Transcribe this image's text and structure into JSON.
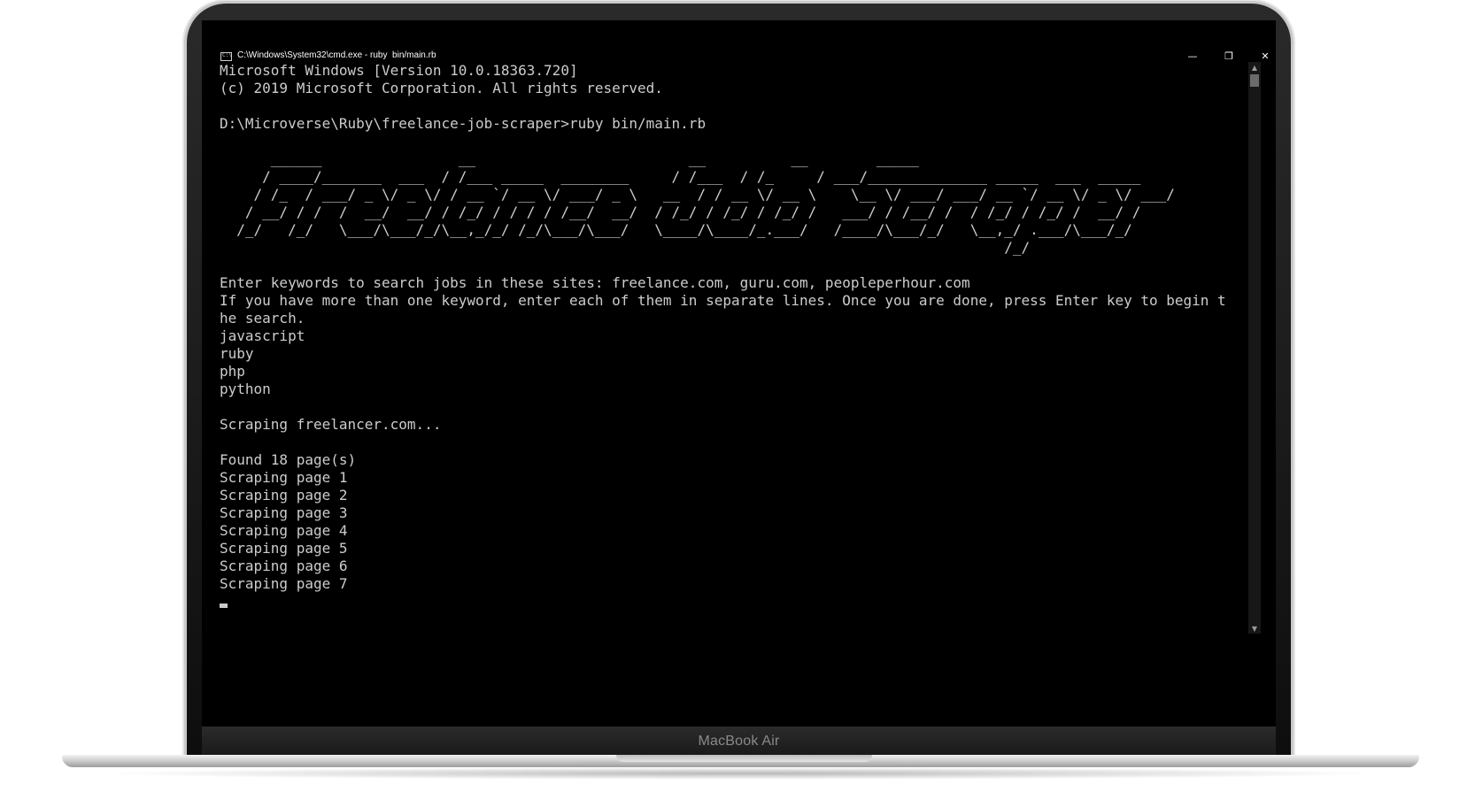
{
  "device": {
    "label": "MacBook Air"
  },
  "window": {
    "title": "C:\\Windows\\System32\\cmd.exe - ruby  bin/main.rb",
    "minimize_glyph": "—",
    "maximize_glyph": "❐",
    "close_glyph": "✕"
  },
  "terminal": {
    "lines": [
      "Microsoft Windows [Version 10.0.18363.720]",
      "(c) 2019 Microsoft Corporation. All rights reserved.",
      "",
      "D:\\Microverse\\Ruby\\freelance-job-scraper>ruby bin/main.rb",
      "",
      "      ______                __                         __          __        _____",
      "     / ____/_______  ___  / /___ _____  ________     / /___  / /_     / ___/______________ _____  ___  _____",
      "    / /_  / ___/ _ \\/ _ \\/ / __ `/ __ \\/ ___/ _ \\   __  / / __ \\/ __ \\    \\__ \\/ ___/ ___/ __ `/ __ \\/ _ \\/ ___/",
      "   / __/ / /  /  __/  __/ / /_/ / / / / /__/  __/  / /_/ / /_/ / /_/ /   ___/ / /__/ /  / /_/ / /_/ /  __/ /",
      "  /_/   /_/   \\___/\\___/_/\\__,_/_/ /_/\\___/\\___/   \\____/\\____/_.___/   /____/\\___/_/   \\__,_/ .___/\\___/_/",
      "                                                                                            /_/",
      "",
      "Enter keywords to search jobs in these sites: freelance.com, guru.com, peopleperhour.com",
      "If you have more than one keyword, enter each of them in separate lines. Once you are done, press Enter key to begin t",
      "he search.",
      "javascript",
      "ruby",
      "php",
      "python",
      "",
      "Scraping freelancer.com...",
      "",
      "Found 18 page(s)",
      "Scraping page 1",
      "Scraping page 2",
      "Scraping page 3",
      "Scraping page 4",
      "Scraping page 5",
      "Scraping page 6",
      "Scraping page 7"
    ]
  },
  "scrollbar": {
    "up_glyph": "▲",
    "down_glyph": "▼"
  },
  "colors": {
    "terminal_bg": "#000000",
    "terminal_text": "#cccccc"
  }
}
